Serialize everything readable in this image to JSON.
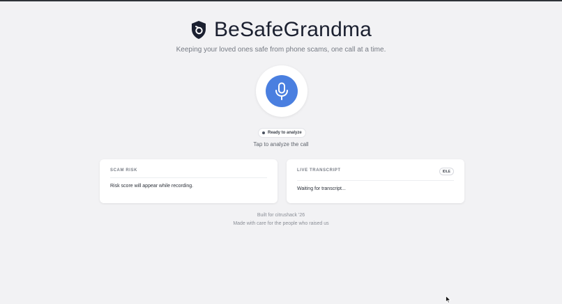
{
  "app": {
    "title": "BeSafeGrandma",
    "tagline": "Keeping your loved ones safe from phone scams, one call at a time.",
    "logo_icon": "shield-icon",
    "accent_color": "#4a7fe0"
  },
  "recorder": {
    "icon": "microphone-icon",
    "status": "Ready to analyze",
    "hint": "Tap to analyze the call"
  },
  "risk_card": {
    "label": "SCAM RISK",
    "body": "Risk score will appear while recording."
  },
  "transcript_card": {
    "label": "LIVE TRANSCRIPT",
    "badge": "IDLE",
    "body": "Waiting for transcript..."
  },
  "footer": {
    "line1": "Built for citrushack '26",
    "line2": "Made with care for the people who raised us"
  }
}
